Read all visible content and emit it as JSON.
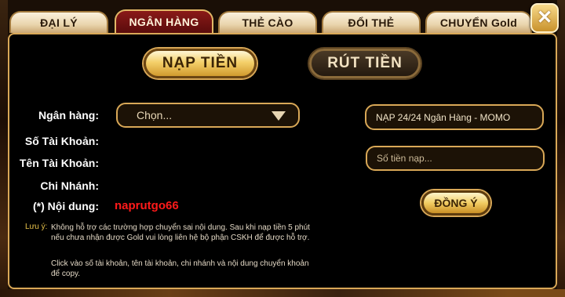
{
  "tabs": [
    {
      "label": "ĐẠI LÝ",
      "active": false
    },
    {
      "label": "NGÂN HÀNG",
      "active": true
    },
    {
      "label": "THẺ CÀO",
      "active": false
    },
    {
      "label": "ĐỔI THẺ",
      "active": false
    },
    {
      "label": "CHUYỂN Gold",
      "active": false
    }
  ],
  "close_icon": "✕",
  "actions": {
    "deposit": "NẠP TIỀN",
    "withdraw": "RÚT TIỀN"
  },
  "form": {
    "bank_label": "Ngân hàng:",
    "bank_select_value": "Chọn...",
    "account_number_label": "Số Tài Khoản:",
    "account_name_label": "Tên Tài Khoản:",
    "branch_label": "Chi Nhánh:",
    "content_label": "(*) Nội dung:",
    "content_value": "naprutgo66"
  },
  "right_panel": {
    "method": "NẠP 24/24 Ngân Hàng - MOMO",
    "amount_placeholder": "Số tiền nạp...",
    "confirm": "ĐỒNG Ý"
  },
  "notes": {
    "heading": "Lưu ý:",
    "line1": "Không hỗ trợ các trường hợp chuyển sai nội dung. Sau khi nạp tiền 5 phút nếu chưa nhận được Gold vui lòng liên hệ bộ phận CSKH để được hỗ trợ.",
    "line2": "Click vào số tài khoản, tên tài khoản, chi nhánh và nội dung chuyển khoản để copy."
  },
  "colors": {
    "accent_gold": "#d9a857",
    "active_tab": "#6e1313",
    "content_code": "#ff1a1a",
    "note_heading": "#e8c24a"
  }
}
